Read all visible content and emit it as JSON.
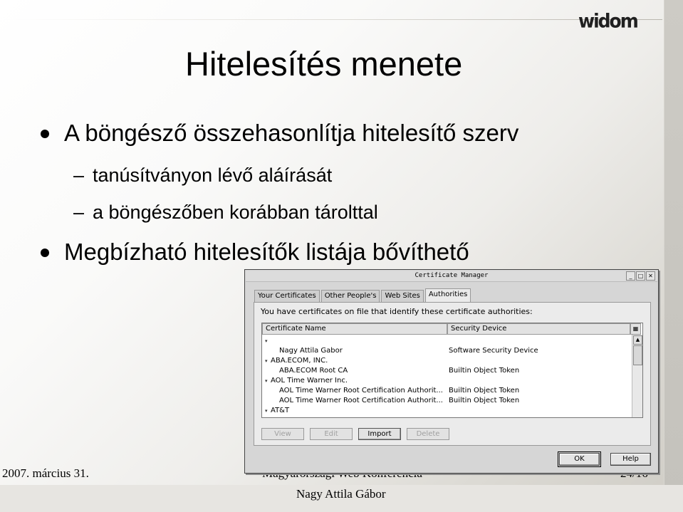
{
  "slide": {
    "logo": "widom",
    "title": "Hitelesítés menete",
    "bullets": [
      {
        "level": 1,
        "text": "A böngésző összehasonlítja hitelesítő szerv"
      },
      {
        "level": 2,
        "text": "tanúsítványon lévő aláírását"
      },
      {
        "level": 2,
        "text": "a böngészőben korábban tárolttal"
      },
      {
        "level": 1,
        "text": "Megbízható hitelesítők listája bővíthető"
      }
    ],
    "dash": "–",
    "footer": {
      "date": "2007. március 31.",
      "center": "Magyarországi Web Konferencia",
      "page": "24/16",
      "author": "Nagy Attila Gábor"
    }
  },
  "dialog": {
    "title": "Certificate Manager",
    "tabs": [
      "Your Certificates",
      "Other People's",
      "Web Sites",
      "Authorities"
    ],
    "active_tab": "Authorities",
    "info_text": "You have certificates on file that identify these certificate authorities:",
    "columns": [
      "Certificate Name",
      "Security Device"
    ],
    "rows": [
      {
        "level": 0,
        "expander": "▾",
        "name": "",
        "device": ""
      },
      {
        "level": 1,
        "name": "Nagy Attila Gabor",
        "device": "Software Security Device"
      },
      {
        "level": 0,
        "expander": "▾",
        "name": "ABA.ECOM, INC.",
        "device": ""
      },
      {
        "level": 1,
        "name": "ABA.ECOM Root CA",
        "device": "Builtin Object Token"
      },
      {
        "level": 0,
        "expander": "▾",
        "name": "AOL Time Warner Inc.",
        "device": ""
      },
      {
        "level": 1,
        "name": "AOL Time Warner Root Certification Authorit...",
        "device": "Builtin Object Token"
      },
      {
        "level": 1,
        "name": "AOL Time Warner Root Certification Authorit...",
        "device": "Builtin Object Token"
      },
      {
        "level": 0,
        "expander": "▾",
        "name": "AT&T",
        "device": ""
      }
    ],
    "buttons": [
      {
        "label": "View",
        "enabled": false
      },
      {
        "label": "Edit",
        "enabled": false
      },
      {
        "label": "Import",
        "enabled": true
      },
      {
        "label": "Delete",
        "enabled": false
      }
    ],
    "ok_label": "OK",
    "help_label": "Help",
    "window_controls": [
      "_",
      "□",
      "✕"
    ],
    "column_picker_icon": "column-picker-icon",
    "scroll_up_glyph": "▲"
  }
}
